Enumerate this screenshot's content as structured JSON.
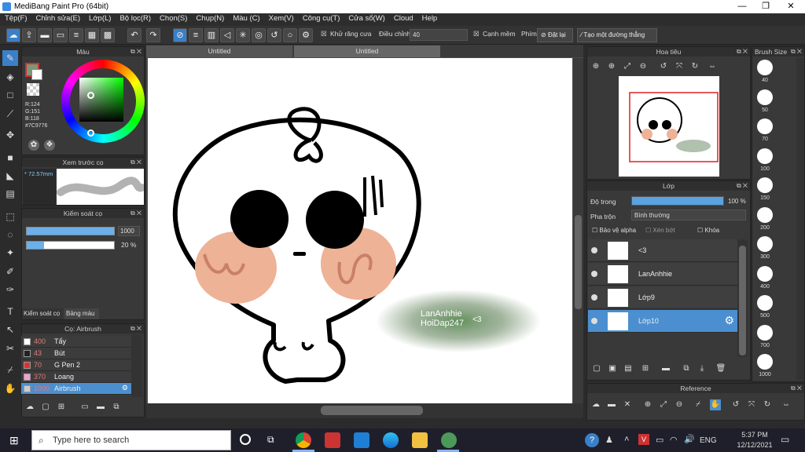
{
  "window": {
    "title": "MediBang Paint Pro (64bit)",
    "minimize": "—",
    "maximize": "❐",
    "close": "✕"
  },
  "menu": [
    "Tệp(F)",
    "Chỉnh sửa(E)",
    "Lớp(L)",
    "Bộ lọc(R)",
    "Chọn(S)",
    "Chụp(N)",
    "Màu (C)",
    "Xem(V)",
    "Công cụ(T)",
    "Cửa sổ(W)",
    "Cloud",
    "Help"
  ],
  "toolbar": {
    "antialias_label": "Khử răng cưa",
    "adjust_label": "Điều chỉnh",
    "adjust_value": "40",
    "edge_label": "Cạnh mềm",
    "key_label": "Phím",
    "reset_label": "Đặt lại",
    "ruler_label": "Tạo một đường thẳng"
  },
  "color_panel": {
    "title": "Màu",
    "r": "R:124",
    "g": "G:151",
    "b": "B:118",
    "hex": "#7C9776",
    "current_color": "#7C9776"
  },
  "brush_preview": {
    "title": "Xem trước cọ",
    "size": "* 72.57mm"
  },
  "brush_control": {
    "title": "Kiểm soát cọ",
    "size_value": "1000",
    "opacity_value": "20 %",
    "opacity_fraction": 0.2,
    "tabs": [
      "Kiểm soát cọ",
      "Bảng màu"
    ]
  },
  "brush_list": {
    "title": "Cọ: Airbrush",
    "items": [
      {
        "num": "400",
        "name": "Tẩy",
        "color": "#ffffff"
      },
      {
        "num": "43",
        "name": "Bút",
        "color": "#222222"
      },
      {
        "num": "70",
        "name": "G Pen 2",
        "color": "#e03030"
      },
      {
        "num": "370",
        "name": "Loang",
        "color": "#f0a0d0"
      },
      {
        "num": "1000",
        "name": "Airbrush",
        "color": "#cccccc"
      }
    ]
  },
  "tabs": [
    "Untitled",
    "Untitled"
  ],
  "canvas": {
    "text1": "LanAnhhie",
    "text2": "HoiDap247",
    "text3": "<3"
  },
  "navigator": {
    "title": "Hoa tiêu"
  },
  "layers": {
    "title": "Lớp",
    "opacity_label": "Độ trong",
    "opacity_value": "100 %",
    "opacity_fraction": 1.0,
    "blend_label": "Pha trộn",
    "blend_value": "Bình thường",
    "protect_alpha": "Bảo vệ alpha",
    "clip": "Xén bớt",
    "lock": "Khóa",
    "items": [
      {
        "name": "<3"
      },
      {
        "name": "LanAnhhie"
      },
      {
        "name": "Lớp9"
      },
      {
        "name": "Lớp10"
      }
    ]
  },
  "reference": {
    "title": "Reference"
  },
  "brush_size": {
    "title": "Brush Size",
    "sizes": [
      "40",
      "50",
      "70",
      "100",
      "150",
      "200",
      "300",
      "400",
      "500",
      "700",
      "1000"
    ]
  },
  "taskbar": {
    "search_placeholder": "Type here to search",
    "time": "5:37 PM",
    "date": "12/12/2021",
    "lang": "ENG"
  }
}
